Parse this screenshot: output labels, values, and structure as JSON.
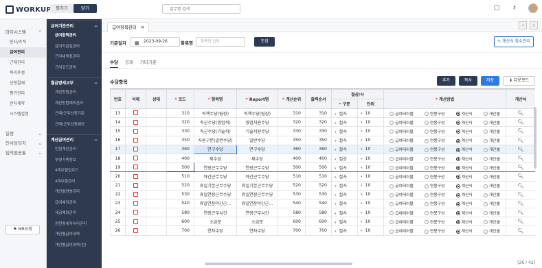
{
  "app": {
    "logo": "WORKUP"
  },
  "topbar": {
    "toggle": [
      "펼치기",
      "닫기"
    ],
    "search_placeholder": "업무명 검색"
  },
  "sidebar1": {
    "section1": "마이시스템",
    "items": [
      "인사/조직",
      "급여관리",
      "근태관리",
      "복리후생",
      "신청결재",
      "평가관리",
      "전자계약",
      "시스템설정"
    ],
    "section2": "일정",
    "section3": "인사담당자",
    "section4": "임직원공통",
    "bottom_button": "MR요청"
  },
  "sidebar2": {
    "groups": [
      {
        "title": "급여기준관리",
        "items": [
          "급여항목관리",
          "급여지급일관리",
          "근여세액표관리",
          "근여코드관리"
        ]
      },
      {
        "title": "월급명세교부",
        "items": [
          "계산방법관리",
          "계산방법예외관리",
          "근태/근무산정기준",
          "근태/근무산정예외"
        ]
      },
      {
        "title": "계산급여관리",
        "items": [
          "인원계산관리",
          "부양가족정보",
          "4대보험업로드",
          "4대보험관리",
          "개인별연봉관리",
          "급여예외관리",
          "세금예외관리",
          "원천명세자처리관리",
          "개인별급여내역",
          "개인별급여내역(전)"
        ]
      }
    ]
  },
  "main": {
    "page_tab": "급여항목관리",
    "filter": {
      "base_date_label": "기준일자",
      "base_date": "2023-09-26",
      "item_label": "항목명",
      "item_placeholder": "항목명 입력",
      "search_button": "조회",
      "formula_button": "계산식 함수관리"
    },
    "subtabs": [
      "수당",
      "공제",
      "기타기준"
    ],
    "section_title": "수당항목",
    "buttons": {
      "add": "추가",
      "copy": "복사",
      "save": "저장",
      "download": "다운로드"
    },
    "columns": {
      "no": "번호",
      "del": "삭제",
      "status": "상태",
      "code": "코드",
      "item": "항목명",
      "report": "Report명",
      "calc_order": "계산순위",
      "out_order": "출력순서",
      "trunc": "절상/사",
      "trunc_type": "구분",
      "trunc_unit": "단위",
      "calc_method": "계산방법",
      "formula": "계산식"
    },
    "calc_options": [
      "급여테이블",
      "연봉구성",
      "계산식",
      "개인별"
    ],
    "rows": [
      {
        "no": "13",
        "code": "310",
        "item": "직책수당(팀장)",
        "report": "직책수당(팀장)",
        "calc": "310",
        "out": "310",
        "type": "절사",
        "unit": "10"
      },
      {
        "no": "14",
        "code": "320",
        "item": "직군수당(영업직)",
        "report": "영업지원수당",
        "calc": "320",
        "out": "320",
        "type": "절사",
        "unit": "10"
      },
      {
        "no": "15",
        "code": "330",
        "item": "직군수당(기술직)",
        "report": "기술지원수당",
        "calc": "330",
        "out": "330",
        "type": "절사",
        "unit": "10"
      },
      {
        "no": "16",
        "code": "350",
        "item": "사원구분(일반수당)",
        "report": "일반수당",
        "calc": "350",
        "out": "350",
        "type": "절사",
        "unit": "10"
      },
      {
        "no": "17",
        "code": "360",
        "item": "연구수당",
        "report": "연구수당",
        "calc": "360",
        "out": "360",
        "type": "절사",
        "unit": "10"
      },
      {
        "no": "18",
        "code": "400",
        "item": "제수당",
        "report": "제수당",
        "calc": "400",
        "out": "400",
        "type": "절상",
        "unit": "10"
      },
      {
        "no": "19",
        "code": "500",
        "item": "연장근무수당",
        "report": "연장근무수당",
        "calc": "500",
        "out": "500",
        "type": "절사",
        "unit": "10"
      },
      {
        "no": "20",
        "code": "510",
        "item": "야간근무수당",
        "report": "야간근무수당",
        "calc": "510",
        "out": "510",
        "type": "절사",
        "unit": "10"
      },
      {
        "no": "21",
        "code": "520",
        "item": "휴일기본근무수당",
        "report": "휴일기본근무수당",
        "calc": "520",
        "out": "520",
        "type": "절사",
        "unit": "10"
      },
      {
        "no": "22",
        "code": "530",
        "item": "휴일연장근무수당",
        "report": "휴일연장근무수당",
        "calc": "530",
        "out": "530",
        "type": "절사",
        "unit": "10"
      },
      {
        "no": "23",
        "code": "540",
        "item": "휴일연장야간근…",
        "report": "휴일연장야간근…",
        "calc": "540",
        "out": "540",
        "type": "절사",
        "unit": "10"
      },
      {
        "no": "24",
        "code": "580",
        "item": "연장근무시간",
        "report": "연장근무시간",
        "calc": "580",
        "out": "580",
        "type": "절사",
        "unit": "10"
      },
      {
        "no": "25",
        "code": "600",
        "item": "소급분",
        "report": "소급분",
        "calc": "600",
        "out": "600",
        "type": "절사",
        "unit": "10"
      },
      {
        "no": "26",
        "code": "700",
        "item": "연차수당",
        "report": "연차수당",
        "calc": "700",
        "out": "700",
        "type": "절사",
        "unit": "10"
      }
    ],
    "pager": "[26 / 42]"
  }
}
